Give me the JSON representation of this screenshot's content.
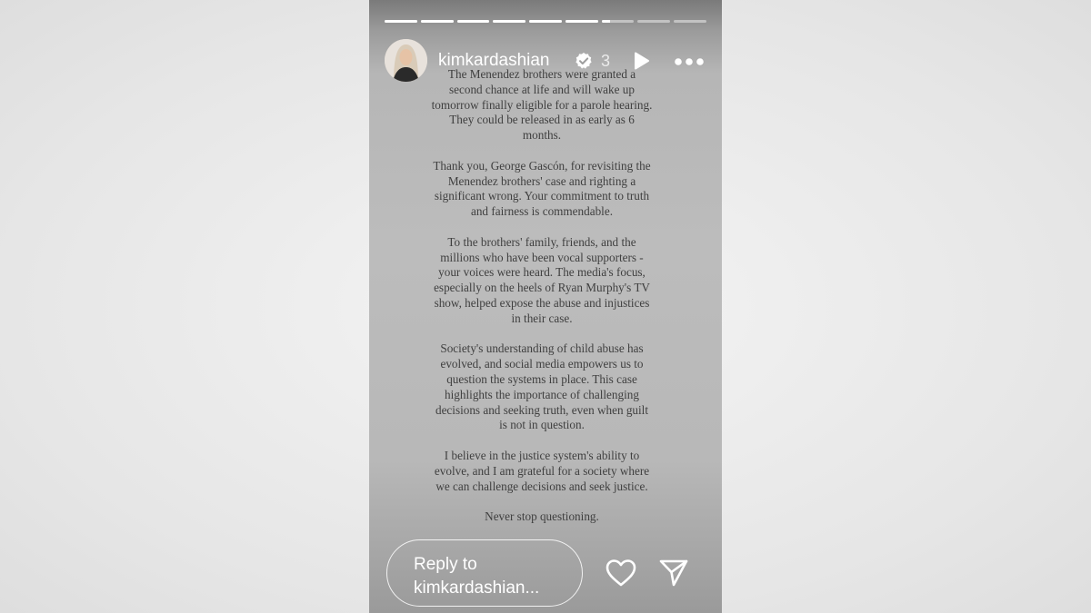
{
  "story": {
    "progress": {
      "segments": [
        1,
        1,
        1,
        1,
        1,
        1,
        0.25,
        0,
        0
      ]
    },
    "header": {
      "username": "kimkardashian",
      "verified": true,
      "time": "3"
    },
    "body": {
      "paragraphs": [
        "The Menendez brothers were granted a second chance at life and will wake up tomorrow finally eligible for a parole hearing. They could be released in as early as 6 months.",
        "Thank you, George Gascón, for revisiting the Menendez brothers' case and righting a significant wrong. Your commitment to truth and fairness is commendable.",
        "To the brothers' family, friends, and the millions who have been vocal supporters - your voices were heard. The media's focus, especially on the heels of Ryan Murphy's TV show, helped expose the abuse and injustices in their case.",
        "Society's understanding of child abuse has evolved, and social media empowers us to question the systems in place. This case highlights the importance of challenging decisions and seeking truth, even when guilt is not in question.",
        "I believe in the justice system's ability to evolve, and I am grateful for a society where we can challenge decisions and seek justice.",
        "Never stop questioning."
      ]
    },
    "footer": {
      "reply_placeholder": "Reply to kimkardashian..."
    },
    "icons": {
      "verified": "verified-badge-icon",
      "play": "play-icon",
      "more": "more-options-icon",
      "heart": "heart-icon",
      "send": "send-icon"
    }
  }
}
